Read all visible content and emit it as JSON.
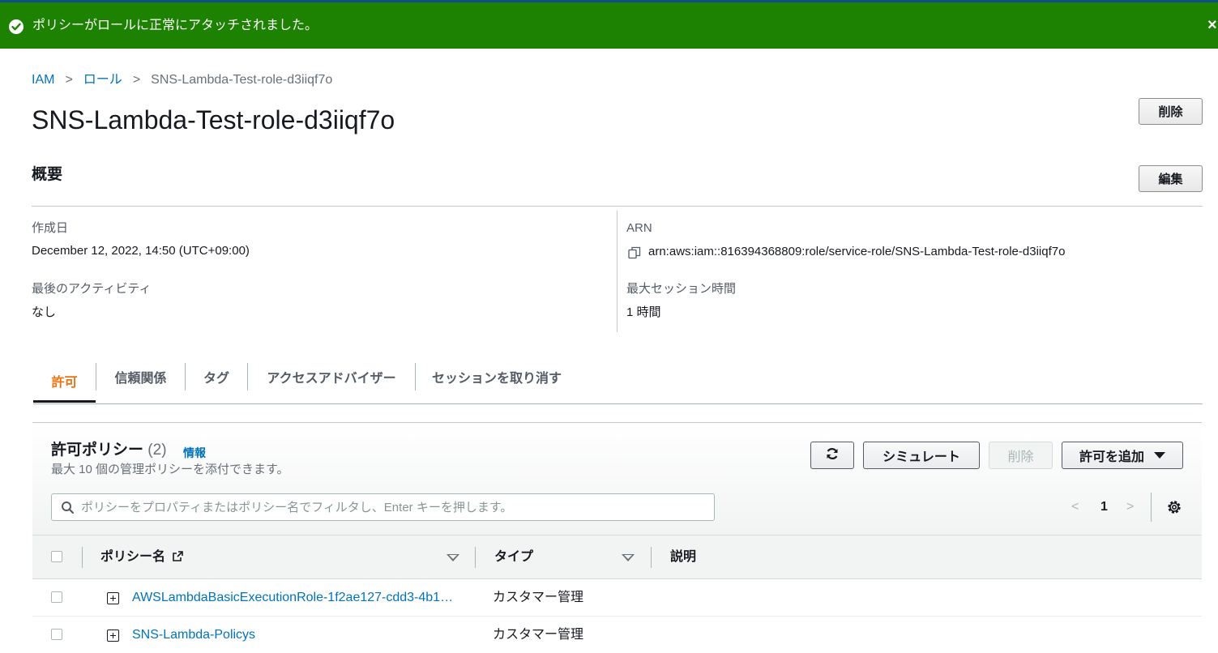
{
  "flash": {
    "message": "ポリシーがロールに正常にアタッチされました。",
    "close_label": "×",
    "color": "#1d8102"
  },
  "breadcrumb": {
    "items": [
      "IAM",
      "ロール",
      "SNS-Lambda-Test-role-d3iiqf7o"
    ],
    "separator": ">"
  },
  "page": {
    "title": "SNS-Lambda-Test-role-d3iiqf7o",
    "delete_label": "削除"
  },
  "summary": {
    "title": "概要",
    "edit_label": "編集",
    "created_label": "作成日",
    "created_value": "December 12, 2022, 14:50 (UTC+09:00)",
    "last_activity_label": "最後のアクティビティ",
    "last_activity_value": "なし",
    "arn_label": "ARN",
    "arn_value": "arn:aws:iam::816394368809:role/service-role/SNS-Lambda-Test-role-d3iiqf7o",
    "max_session_label": "最大セッション時間",
    "max_session_value": "1 時間"
  },
  "tabs": [
    {
      "label": "許可",
      "active": true
    },
    {
      "label": "信頼関係",
      "active": false
    },
    {
      "label": "タグ",
      "active": false
    },
    {
      "label": "アクセスアドバイザー",
      "active": false
    },
    {
      "label": "セッションを取り消す",
      "active": false
    }
  ],
  "policies": {
    "title": "許可ポリシー",
    "count": "(2)",
    "info_label": "情報",
    "description": "最大 10 個の管理ポリシーを添付できます。",
    "refresh_icon": "refresh-icon",
    "simulate_label": "シミュレート",
    "delete_label": "削除",
    "add_label": "許可を追加",
    "search_placeholder": "ポリシーをプロパティまたはポリシー名でフィルタし、Enter キーを押します。",
    "page_prev": "<",
    "page_number": "1",
    "page_next": ">",
    "columns": [
      "ポリシー名",
      "タイプ",
      "説明"
    ],
    "rows": [
      {
        "name": "AWSLambdaBasicExecutionRole-1f2ae127-cdd3-4b13…",
        "type": "カスタマー管理",
        "description": ""
      },
      {
        "name": "SNS-Lambda-Policys",
        "type": "カスタマー管理",
        "description": ""
      }
    ]
  },
  "colors": {
    "accent": "#ec7211",
    "link": "#0073bb",
    "success": "#1d8102"
  }
}
